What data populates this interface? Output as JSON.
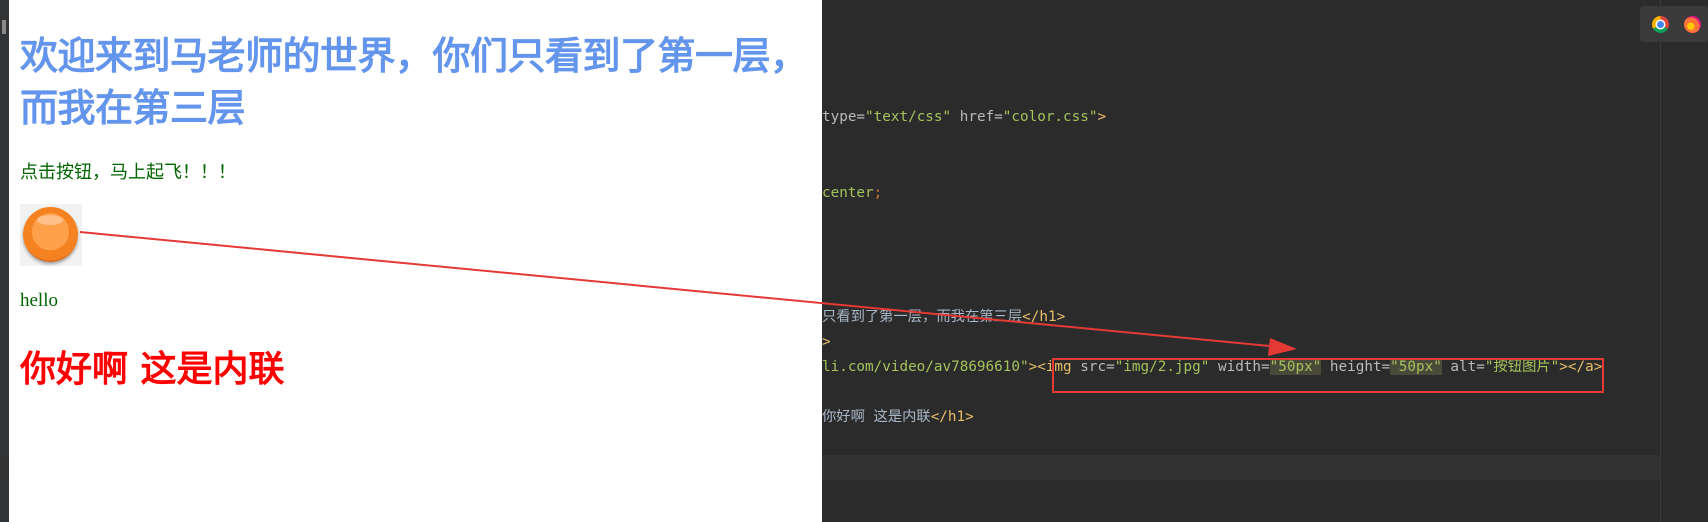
{
  "page": {
    "heading": "欢迎来到马老师的世界，你们只看到了第一层，而我在第三层",
    "paragraph": "点击按钮，马上起飞！！！",
    "button_alt": "按钮图片",
    "hello": "hello",
    "inline_heading": "你好啊 这是内联"
  },
  "editor": {
    "line1": {
      "attr_type": "type=",
      "val_type": "\"text/css\"",
      "attr_href": " href=",
      "val_href": "\"color.css\"",
      "tag_close": ">"
    },
    "line2": {
      "value": "center",
      "punct": ";"
    },
    "line3": {
      "text": "只看到了第一层，而我在第三层",
      "tag": "</h1>"
    },
    "line4": {
      "tag": ">"
    },
    "line5": {
      "href_tail": "li.com/video/av78696610\"",
      "tag_open": "><",
      "img_tag": "img",
      "src_attr": " src=",
      "src_val": "\"img/2.jpg\"",
      "width_attr": " width=",
      "width_val": "\"50px\"",
      "height_attr": " height=",
      "height_val": "\"50px\"",
      "alt_attr": " alt=",
      "alt_val": "\"按钮图片\"",
      "tag_end": "></a>"
    },
    "line6": {
      "text": "你好啊 这是内联",
      "tag": "</h1>"
    }
  },
  "colors": {
    "heading": "#6495ed",
    "paragraph": "#006400",
    "inline_heading": "#ff0000",
    "annotation": "#e53935",
    "editor_bg": "#2b2b2b"
  },
  "icons": [
    "chrome-icon",
    "firefox-icon"
  ]
}
